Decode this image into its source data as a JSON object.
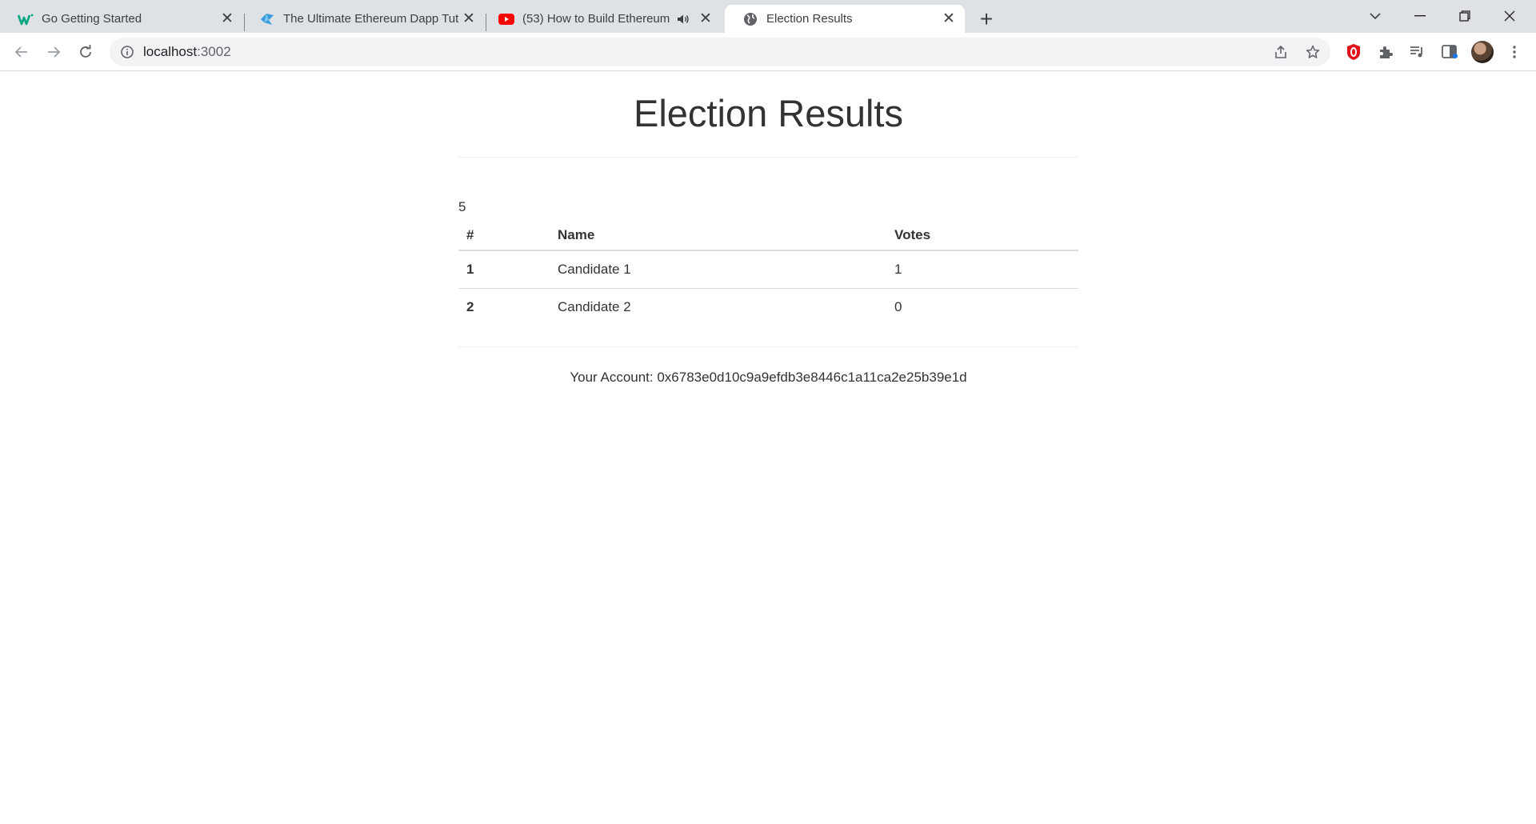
{
  "browser": {
    "tabs": [
      {
        "title": "Go Getting Started",
        "icon": "w-logo-icon",
        "active": false
      },
      {
        "title": "The Ultimate Ethereum Dapp Tut",
        "icon": "ethereum-bird-icon",
        "active": false
      },
      {
        "title": "(53) How to Build Ethereum",
        "icon": "youtube-icon",
        "active": false,
        "audio": true
      },
      {
        "title": "Election Results",
        "icon": "globe-icon",
        "active": true
      }
    ],
    "address": {
      "host": "localhost",
      "port": ":3002"
    }
  },
  "page": {
    "heading": "Election Results",
    "candidates_count": "5",
    "table": {
      "headers": [
        "#",
        "Name",
        "Votes"
      ],
      "rows": [
        {
          "id": "1",
          "name": "Candidate 1",
          "votes": "1"
        },
        {
          "id": "2",
          "name": "Candidate 2",
          "votes": "0"
        }
      ]
    },
    "account": "Your Account: 0x6783e0d10c9a9efdb3e8446c1a11ca2e25b39e1d"
  },
  "colors": {
    "youtube": "#ff0000",
    "wasp": "#00a67e",
    "ethereum": "#3a9bdc",
    "opera": "#e0131b"
  }
}
